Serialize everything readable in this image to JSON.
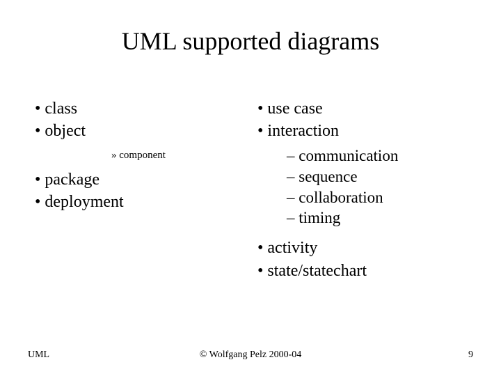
{
  "title": "UML supported diagrams",
  "left": {
    "items_top": [
      "class",
      "object"
    ],
    "sub_item": "component",
    "items_bottom": [
      "package",
      "deployment"
    ]
  },
  "right": {
    "items_top": [
      "use case",
      "interaction"
    ],
    "sub_items": [
      "communication",
      "sequence",
      "collaboration",
      "timing"
    ],
    "items_bottom": [
      "activity",
      "state/statechart"
    ]
  },
  "footer": {
    "left": "UML",
    "center": "© Wolfgang Pelz 2000-04",
    "right": "9"
  }
}
